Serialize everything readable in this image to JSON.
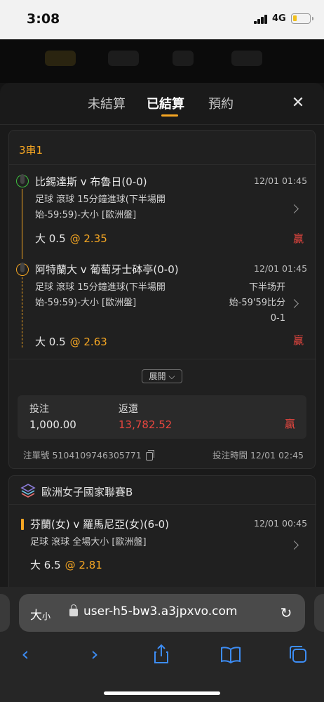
{
  "status": {
    "time": "3:08",
    "network": "4G"
  },
  "tabs": [
    {
      "label": "未結算",
      "active": false
    },
    {
      "label": "已結算",
      "active": true
    },
    {
      "label": "預約",
      "active": false
    }
  ],
  "close_icon": "close-icon",
  "bet1": {
    "type": "3串1",
    "legs": [
      {
        "match": "比錫達斯 v 布魯日(0-0)",
        "time": "12/01 01:45",
        "market_line1": "足球 滾球   15分鐘進球(下半場開",
        "market_line2": "始-59:59)-大小 [歐洲盤]",
        "pick": "大 0.5",
        "odds": "@ 2.35",
        "result": "贏",
        "status_color": "#3fbf3f"
      },
      {
        "match": "阿特蘭大 v 葡萄牙士砵亭(0-0)",
        "time": "12/01 01:45",
        "market_line1": "足球 滾球   15分鐘進球(下半場開",
        "market_line2": "始-59:59)-大小 [歐洲盤]",
        "score_line1": "下半场开",
        "score_line2": "始-59'59比分",
        "score_line3": "0-1",
        "pick": "大 0.5",
        "odds": "@ 2.63",
        "result": "贏",
        "status_color": "#f5a623"
      }
    ],
    "expand_label": "展開",
    "stake_label": "投注",
    "stake_value": "1,000.00",
    "return_label": "返還",
    "return_value": "13,782.52",
    "result": "贏",
    "order_no": "注單號 5104109746305771",
    "bet_time": "投注時間 12/01 02:45"
  },
  "bet2": {
    "league": "歐洲女子國家聯賽B",
    "match": "芬蘭(女) v 羅馬尼亞(女)(6-0)",
    "time": "12/01 00:45",
    "market": "足球 滾球   全場大小 [歐洲盤]",
    "pick": "大 6.5",
    "odds": "@ 2.81"
  },
  "browser": {
    "text_size_label": "大",
    "text_size_small": "小",
    "url": "user-h5-bw3.a3jpxvo.com"
  },
  "colors": {
    "accent": "#f5a623",
    "win": "#e8463f",
    "link": "#3d8df5"
  }
}
